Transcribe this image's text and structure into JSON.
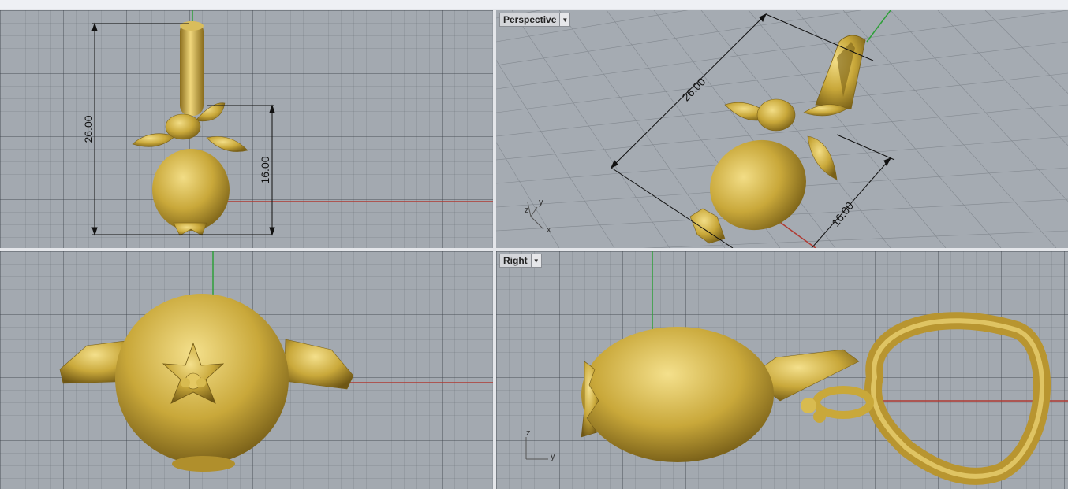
{
  "viewports": {
    "top": {
      "label": ""
    },
    "perspective": {
      "label": "Perspective"
    },
    "front": {
      "label": ""
    },
    "right": {
      "label": "Right"
    }
  },
  "dimensions": {
    "total_height": "26.00",
    "body_height": "16.00"
  },
  "axis_labels": {
    "x": "x",
    "y": "y",
    "z": "z"
  },
  "colors": {
    "viewport_bg": "#a3a9b0",
    "gold": "#c9a83a",
    "x_axis": "#b03a32",
    "y_axis": "#2fa03a"
  }
}
